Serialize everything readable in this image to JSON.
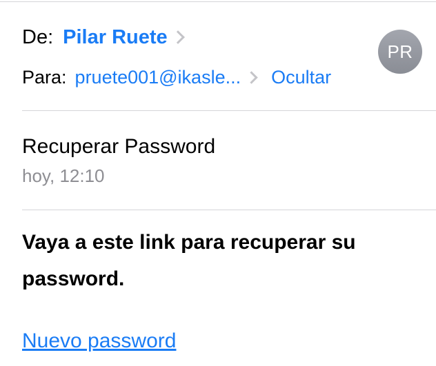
{
  "header": {
    "from_label": "De:",
    "sender_name": "Pilar Ruete",
    "to_label": "Para:",
    "recipient": "pruete001@ikasle...",
    "hide_label": "Ocultar",
    "avatar_initials": "PR",
    "chevron_icon": "chevron-right-icon"
  },
  "message": {
    "subject": "Recuperar Password",
    "date": "hoy, 12:10",
    "body": "Vaya a este link para recuperar su password.",
    "link_text": "Nuevo password"
  },
  "colors": {
    "accent": "#1a7cf5",
    "secondary_text": "#8e8e93",
    "separator": "#d4d4d8",
    "avatar_bg": "#9a9da5"
  }
}
